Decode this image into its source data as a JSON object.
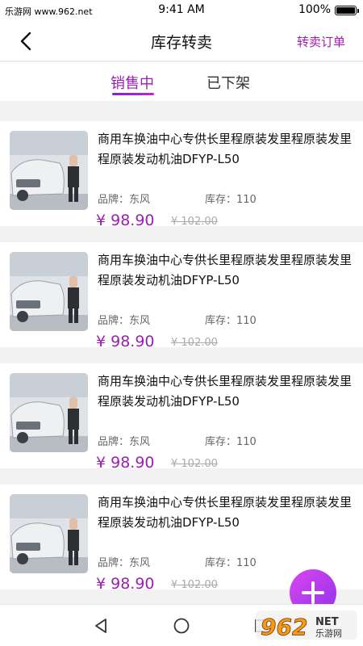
{
  "status_bar": {
    "carrier": "乐游网 www.962.net",
    "time": "9:41 AM",
    "battery": "100%"
  },
  "nav": {
    "title": "库存转卖",
    "right_link": "转卖订单"
  },
  "tabs": [
    {
      "label": "销售中",
      "active": true
    },
    {
      "label": "已下架",
      "active": false
    }
  ],
  "products": [
    {
      "name": "商用车换油中心专供长里程原装发里程原装发里程原装发动机油DFYP-L50",
      "brand": "品牌：东风",
      "stock": "库存：110",
      "price": "¥ 98.90",
      "old_price": "¥ 102.00"
    },
    {
      "name": "商用车换油中心专供长里程原装发里程原装发里程原装发动机油DFYP-L50",
      "brand": "品牌：东风",
      "stock": "库存：110",
      "price": "¥ 98.90",
      "old_price": "¥ 102.00"
    },
    {
      "name": "商用车换油中心专供长里程原装发里程原装发里程原装发动机油DFYP-L50",
      "brand": "品牌：东风",
      "stock": "库存：110",
      "price": "¥ 98.90",
      "old_price": "¥ 102.00"
    },
    {
      "name": "商用车换油中心专供长里程原装发里程原装发里程原装发动机油DFYP-L50",
      "brand": "品牌：东风",
      "stock": "库存：110",
      "price": "¥ 98.90",
      "old_price": "¥ 102.00"
    }
  ],
  "watermark": {
    "number": "962",
    "suffix": "NET",
    "sub": "乐游网"
  },
  "icons": {
    "back": "chevron-left-icon",
    "fab": "plus-icon",
    "nav_back": "triangle-back-icon",
    "nav_home": "circle-home-icon",
    "nav_recent": "square-recent-icon"
  },
  "colors": {
    "accent": "#9b1fb0",
    "fab_start": "#d946ef",
    "fab_end": "#9333ea"
  }
}
